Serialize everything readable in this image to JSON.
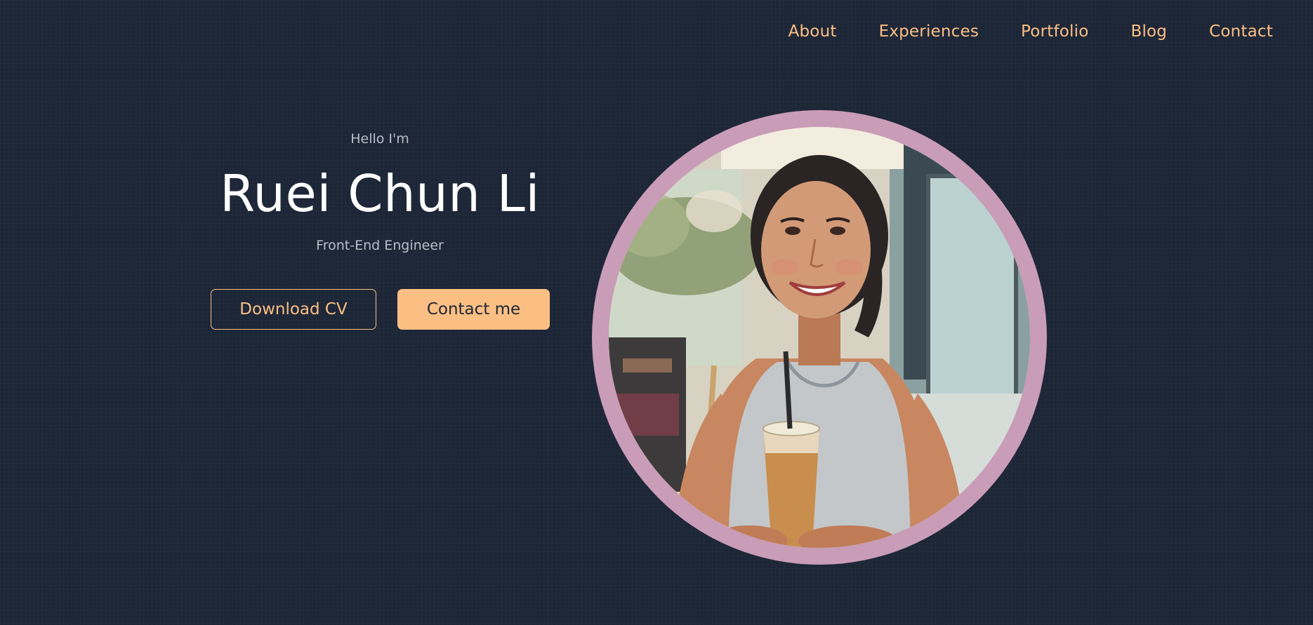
{
  "nav": {
    "items": [
      {
        "label": "About"
      },
      {
        "label": "Experiences"
      },
      {
        "label": "Portfolio"
      },
      {
        "label": "Blog"
      },
      {
        "label": "Contact"
      }
    ]
  },
  "hero": {
    "greeting": "Hello I'm",
    "name": "Ruei Chun Li",
    "role": "Front-End Engineer",
    "download_cv_label": "Download CV",
    "contact_me_label": "Contact me"
  },
  "colors": {
    "background": "#1d2636",
    "accent": "#fbbf84",
    "portrait_ring": "#c99cb7",
    "muted_text": "#b9bec8"
  }
}
